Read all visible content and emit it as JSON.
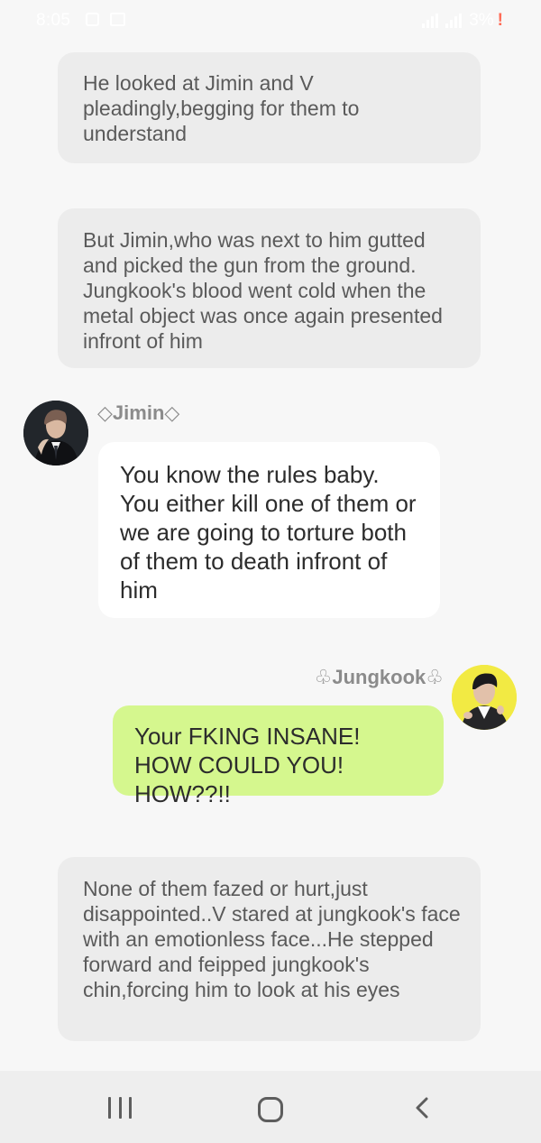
{
  "status_bar": {
    "time": "8:05",
    "battery": "3%",
    "battery_alert": "!"
  },
  "story": {
    "narration_1": "He looked at Jimin and V pleadingly,begging for them to understand",
    "narration_2": "But Jimin,who was next to him gutted and picked the gun from the ground. Jungkook's blood went cold when the metal object was once again presented infront of him",
    "jimin_name": "◇Jimin◇",
    "jimin_message": "You know the rules baby. You either kill one of them or we are going to torture both of them to death infront of him",
    "jungkook_name": "♧Jungkook♧",
    "jungkook_message": "Your FKING INSANE! HOW COULD YOU! HOW??!!",
    "narration_3": "None of them fazed or hurt,just disappointed..V stared at jungkook's face with an emotionless face...He stepped forward and feipped jungkook's chin,forcing him to look at his eyes"
  },
  "colors": {
    "page_background": "#f7f7f7",
    "narration_bubble": "#ececec",
    "jimin_bubble": "#ffffff",
    "jungkook_bubble": "#d5f78e",
    "jungkook_avatar_background": "#f2ea43",
    "status_battery_alert": "#ff6c57"
  },
  "navigation": {
    "recent_icon": "recent-apps-icon",
    "home_icon": "home-icon",
    "back_icon": "back-icon"
  }
}
